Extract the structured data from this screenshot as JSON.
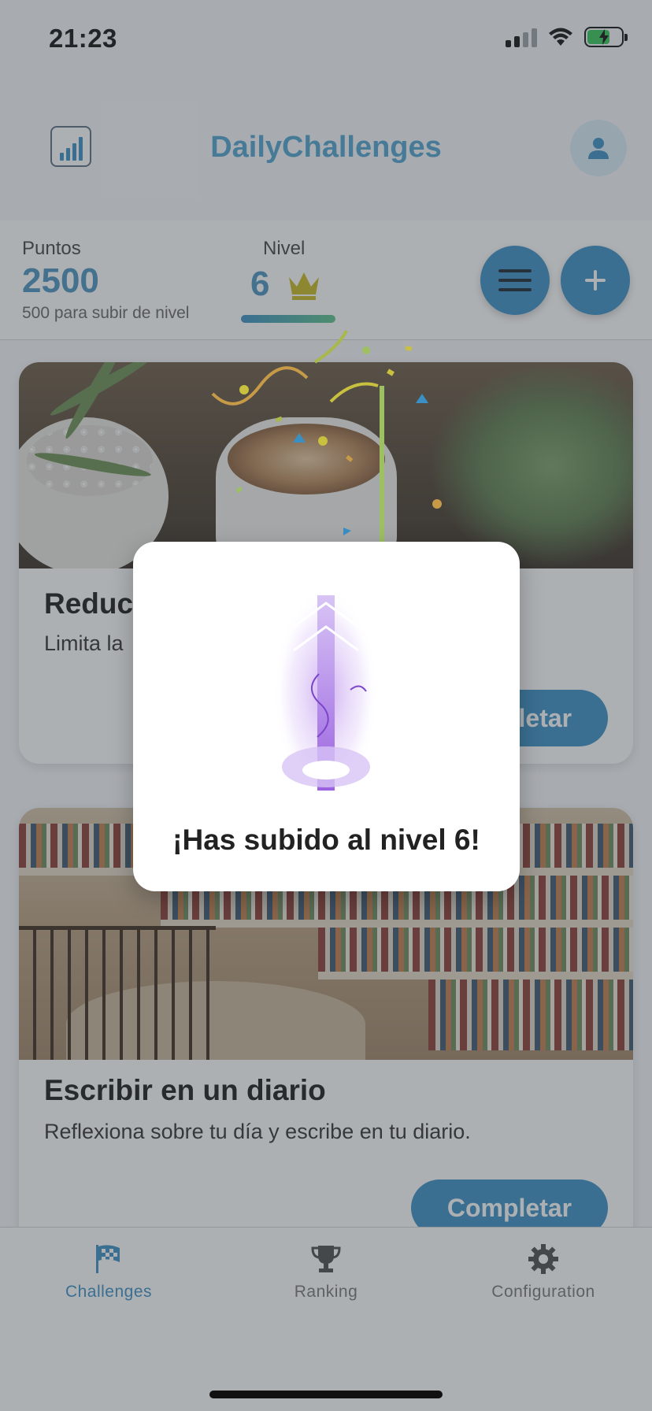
{
  "status_bar": {
    "time": "21:23"
  },
  "header": {
    "logo_name": "DailyChallenges",
    "title": "DailyChallenges"
  },
  "stats": {
    "points_label": "Puntos",
    "points_value": "2500",
    "points_subtitle": "500 para subir de nivel",
    "level_label": "Nivel",
    "level_value": "6"
  },
  "challenges": [
    {
      "title": "Reducir",
      "description": "Limita la",
      "button_label": "Completar"
    },
    {
      "title": "Escribir en un diario",
      "description": "Reflexiona sobre tu día y escribe en tu diario.",
      "button_label": "Completar"
    }
  ],
  "tabs": [
    {
      "label": "Challenges",
      "icon": "checkered-flag-icon",
      "active": true
    },
    {
      "label": "Ranking",
      "icon": "trophy-icon",
      "active": false
    },
    {
      "label": "Configuration",
      "icon": "gear-icon",
      "active": false
    }
  ],
  "modal": {
    "title": "¡Has subido al nivel 6!"
  },
  "colors": {
    "accent": "#3a8fc4",
    "title": "#4fa3cf",
    "active_tab": "#3a8fc4"
  }
}
